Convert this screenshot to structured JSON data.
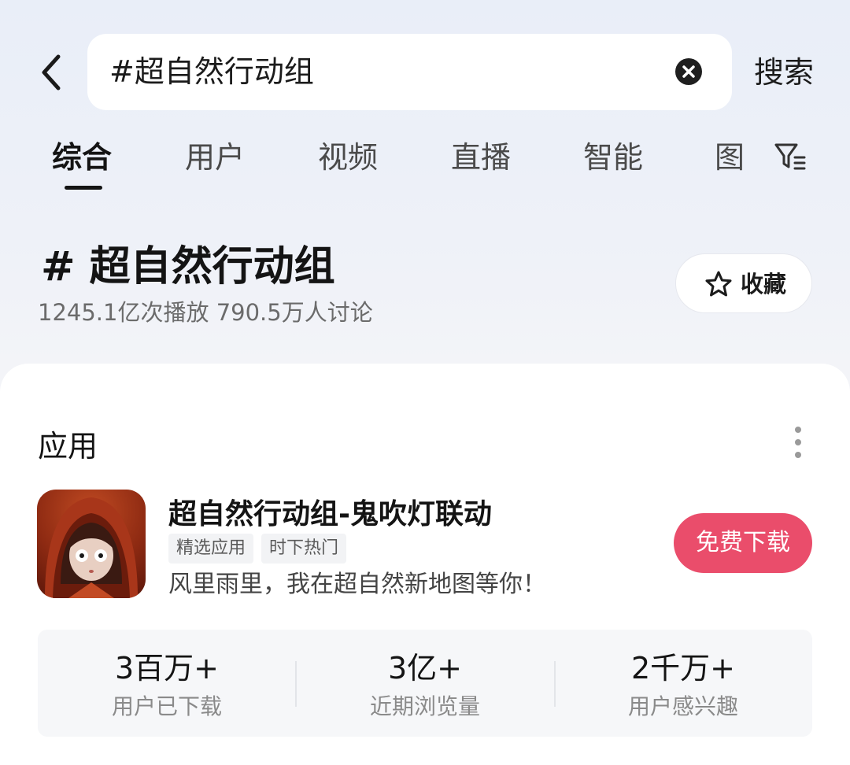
{
  "search": {
    "query": "#超自然行动组",
    "submit_label": "搜索"
  },
  "icons": {
    "back": "chevron-left-icon",
    "clear": "close-circle-icon",
    "filter": "filter-icon",
    "favorite": "star-outline-icon",
    "more": "more-vertical-icon"
  },
  "tabs": [
    {
      "label": "综合",
      "active": true
    },
    {
      "label": "用户",
      "active": false
    },
    {
      "label": "视频",
      "active": false
    },
    {
      "label": "直播",
      "active": false
    },
    {
      "label": "智能",
      "active": false
    },
    {
      "label": "图",
      "active": false
    }
  ],
  "topic": {
    "title": "# 超自然行动组",
    "stats": "1245.1亿次播放 790.5万人讨论",
    "favorite_label": "收藏"
  },
  "apps_section": {
    "title": "应用",
    "app": {
      "name": "超自然行动组-鬼吹灯联动",
      "tags": [
        "精选应用",
        "时下热门"
      ],
      "description": "风里雨里，我在超自然新地图等你！",
      "download_label": "免费下载"
    },
    "stats": [
      {
        "value": "3百万+",
        "label": "用户已下载"
      },
      {
        "value": "3亿+",
        "label": "近期浏览量"
      },
      {
        "value": "2千万+",
        "label": "用户感兴趣"
      }
    ]
  },
  "colors": {
    "accent": "#ea4d6b",
    "text_primary": "#141414",
    "text_secondary": "#6b6b6b"
  }
}
